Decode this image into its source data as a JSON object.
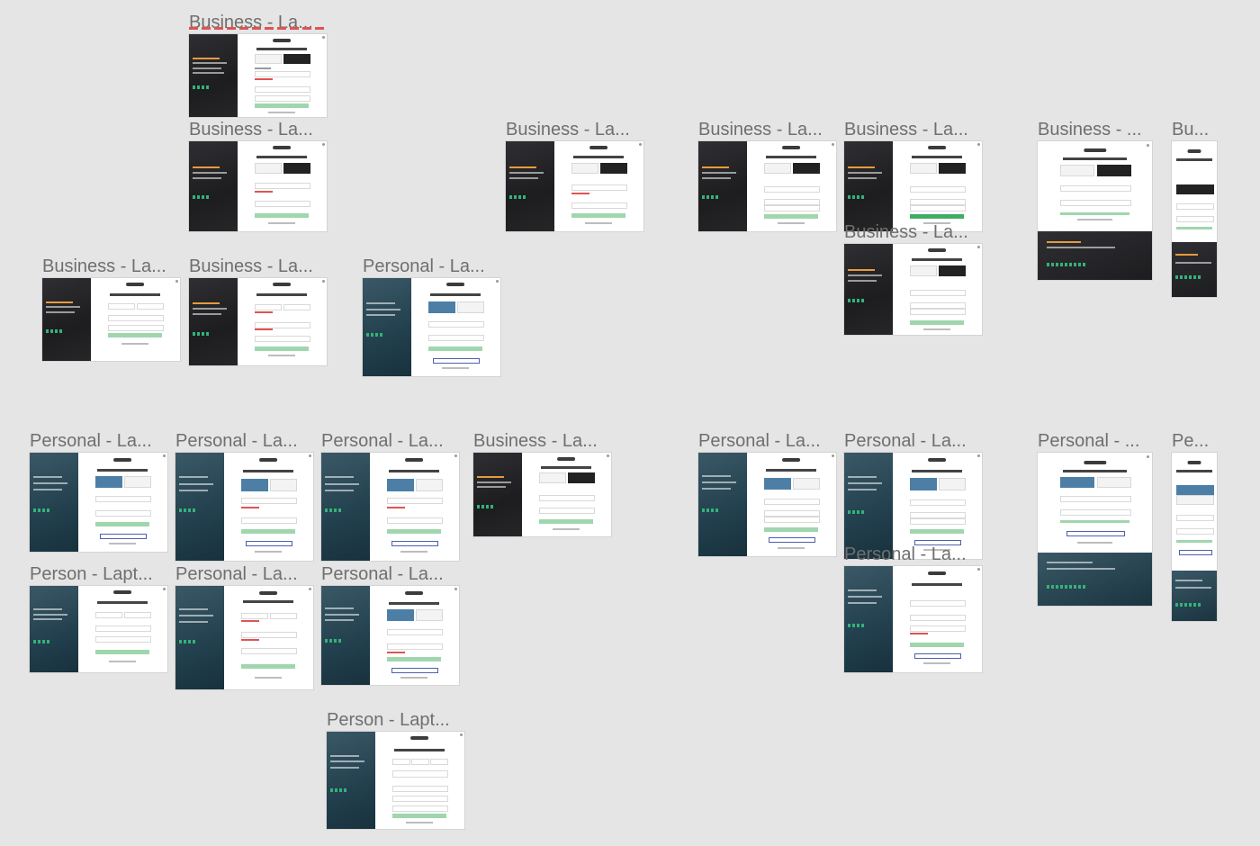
{
  "canvas": {
    "background": "#e5e5e5"
  },
  "frames": [
    {
      "title": "Business - La..."
    },
    {
      "title": "Business - La..."
    },
    {
      "title": "Business - La..."
    },
    {
      "title": "Business - La..."
    },
    {
      "title": "Business - La..."
    },
    {
      "title": "Business - La..."
    },
    {
      "title": "Business - ..."
    },
    {
      "title": "Bu..."
    },
    {
      "title": "Business - La..."
    },
    {
      "title": "Business - La..."
    },
    {
      "title": "Personal - La..."
    },
    {
      "title": "Personal - La..."
    },
    {
      "title": "Personal - La..."
    },
    {
      "title": "Personal - La..."
    },
    {
      "title": "Business - La..."
    },
    {
      "title": "Personal - La..."
    },
    {
      "title": "Personal - La..."
    },
    {
      "title": "Personal - ..."
    },
    {
      "title": "Pe..."
    },
    {
      "title": "Person - Lapt..."
    },
    {
      "title": "Personal - La..."
    },
    {
      "title": "Personal - La..."
    },
    {
      "title": "Personal - La..."
    },
    {
      "title": "Person - Lapt..."
    }
  ],
  "colors": {
    "business_panel": "#262628",
    "personal_panel": "#23414f",
    "accent_orange": "#e79a3c",
    "cta_green": "#9fd6ae",
    "cta_green_strong": "#3fae64",
    "error_red": "#e05353",
    "toggle_blue": "#4d7fa6",
    "facebook_blue": "#4e5fb0"
  }
}
